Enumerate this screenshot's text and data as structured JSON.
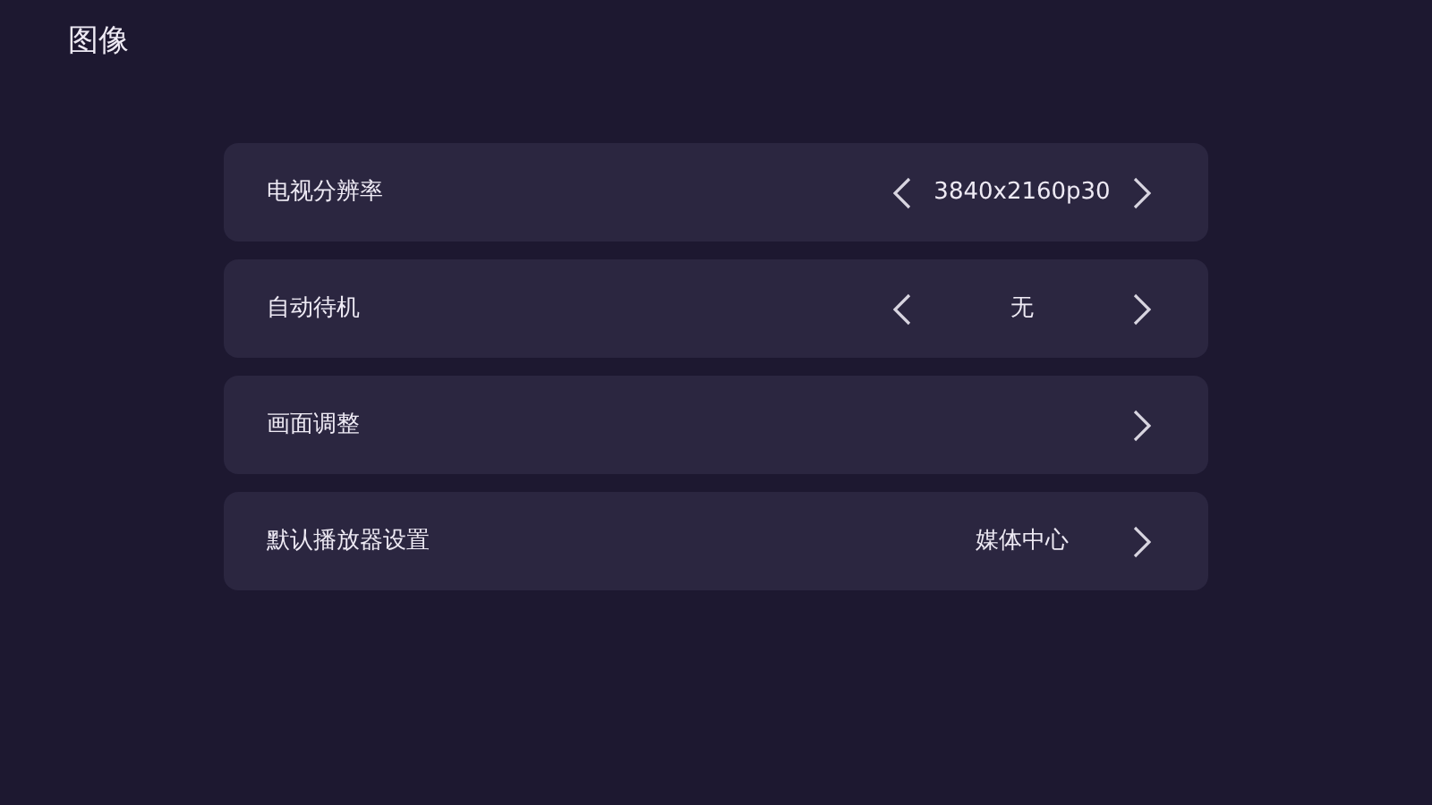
{
  "title": "图像",
  "items": [
    {
      "kind": "selector",
      "label": "电视分辨率",
      "value": "3840x2160p30"
    },
    {
      "kind": "selector",
      "label": "自动待机",
      "value": "无"
    },
    {
      "kind": "link",
      "label": "画面调整"
    },
    {
      "kind": "link",
      "label": "默认播放器设置",
      "value": "媒体中心"
    }
  ]
}
